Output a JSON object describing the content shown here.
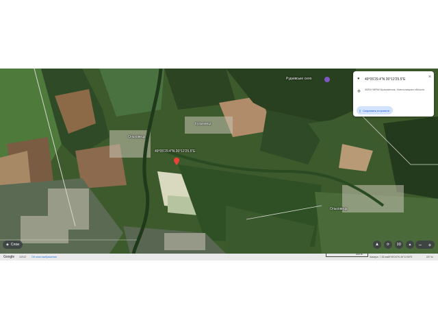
{
  "map": {
    "place_labels": {
      "rudnevske": "Руднівське село",
      "kuzmyntsi": "Кузьминці",
      "olkhovets_left": "Ольховець",
      "olkhovets_right": "Ольховець",
      "marker_coords": "49°05'29.4\"N 26°12'25.5\"E"
    },
    "layers_button": "Слои"
  },
  "info_card": {
    "coords": "49°05'29.4\"N 26°12'25.5\"E",
    "address": "36R4+MRW Кузьминчик, Хмельницкая область",
    "save_button": "Сохранить в проекте",
    "close": "×",
    "pin_icon": "location-pin-icon",
    "move_icon": "crosshair-icon"
  },
  "controls": {
    "pegman": "pegman-icon",
    "rotate": "rotate-icon",
    "mode_3d": "3D",
    "compass": "compass-icon",
    "zoom_out": "−",
    "zoom_in": "+"
  },
  "bottom_bar": {
    "google": "Google",
    "year": "1/2/12",
    "report": "Об этом изображении",
    "scale": "500 м",
    "camera": "Камера: 7,36 км",
    "cursor_coords": "49°05'24\"N 26°11'50\"E",
    "elevation": "227 м"
  }
}
